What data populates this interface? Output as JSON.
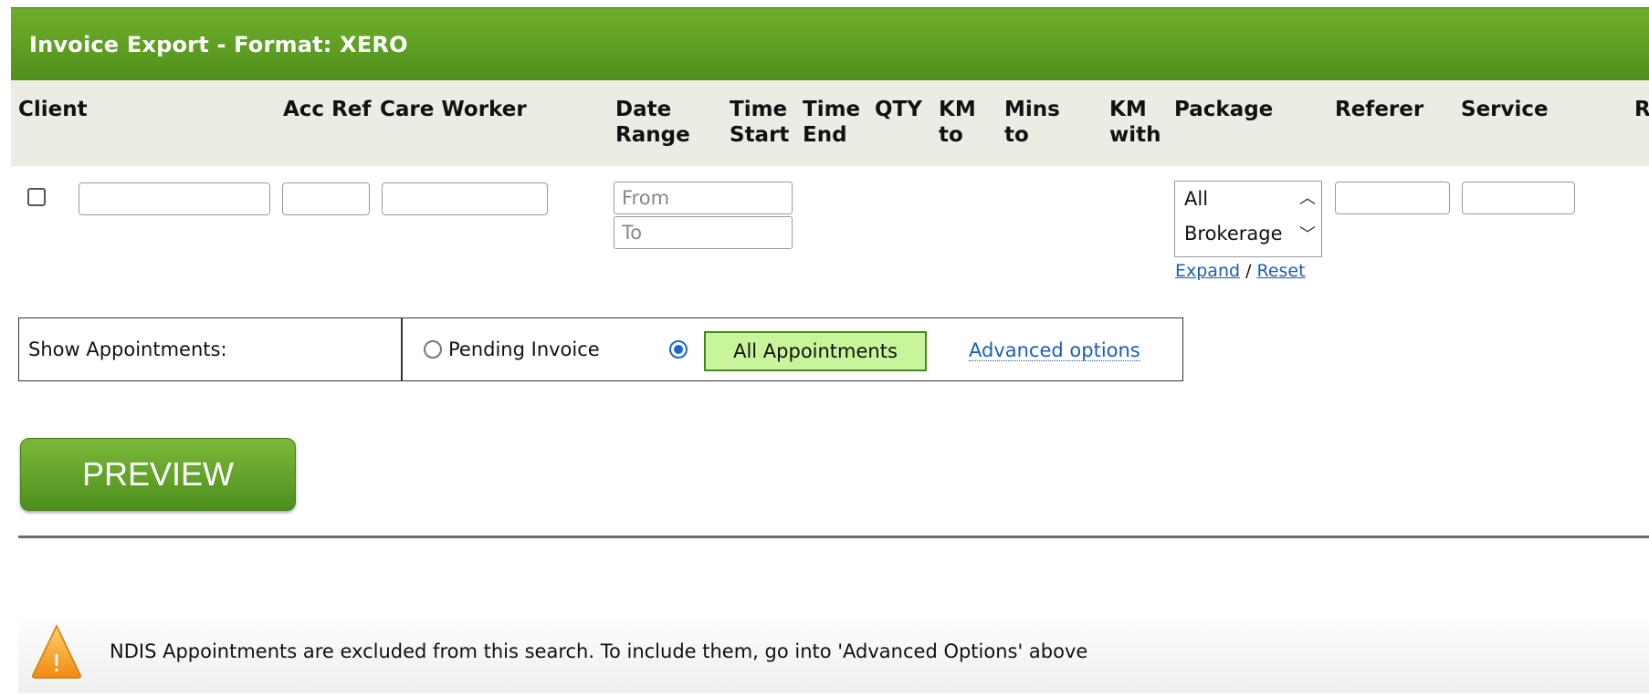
{
  "window": {
    "title": "Invoice Export - Format: XERO"
  },
  "columns": {
    "client": "Client",
    "acc_ref": "Acc Ref",
    "care_worker": "Care Worker",
    "date_range": [
      "Date",
      "Range"
    ],
    "time_start": [
      "Time",
      "Start"
    ],
    "time_end": [
      "Time",
      "End"
    ],
    "qty": "QTY",
    "km_to": [
      "KM",
      "to"
    ],
    "mins_to": [
      "Mins",
      "to"
    ],
    "km_with": [
      "KM",
      "with"
    ],
    "package": "Package",
    "referer": "Referer",
    "service": "Service",
    "cut_off": "R"
  },
  "filters": {
    "date_from_placeholder": "From",
    "date_to_placeholder": "To",
    "package_options": [
      "All",
      "Brokerage"
    ],
    "expand_link": "Expand",
    "separator": "/",
    "reset_link": "Reset"
  },
  "appointments": {
    "label": "Show Appointments:",
    "pending_option": "Pending Invoice",
    "all_option": "All Appointments",
    "selected": "All Appointments",
    "advanced_link": "Advanced options"
  },
  "preview_button": "PREVIEW",
  "warning": {
    "icon": "warning-icon",
    "mark": "!",
    "text": "NDIS Appointments are excluded from this search. To include them, go into 'Advanced Options' above"
  },
  "colors": {
    "header_green": "#5a9e22",
    "selected_highlight": "#c8f59a",
    "link_blue": "#1a5fb4"
  }
}
